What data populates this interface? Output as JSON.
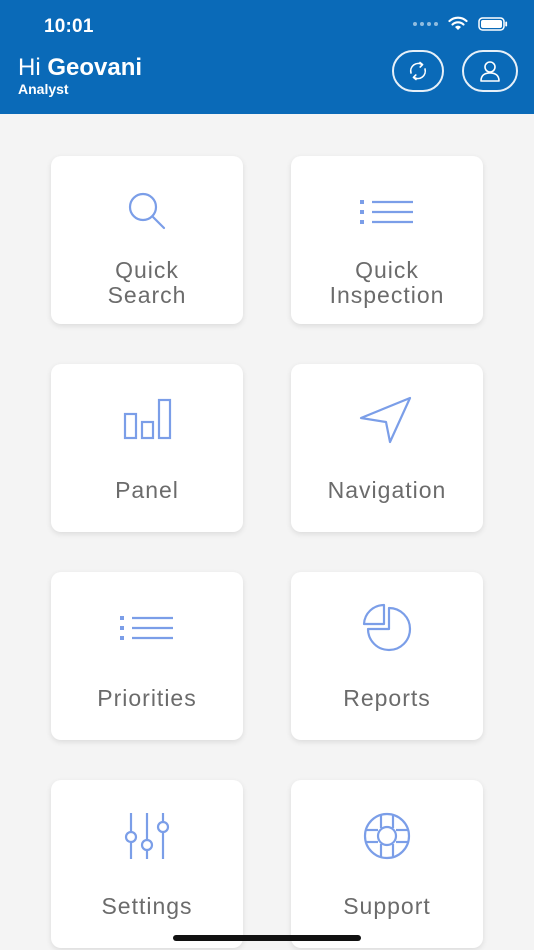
{
  "status_bar": {
    "time": "10:01"
  },
  "header": {
    "greeting_prefix": "Hi",
    "user_name": "Geovani",
    "role": "Analyst",
    "sync_icon": "sync-icon",
    "profile_icon": "user-icon"
  },
  "colors": {
    "header_bg": "#0a6ab8",
    "icon_accent": "#7b9ee8",
    "tile_text": "#6b6b6b",
    "page_bg": "#f4f4f4"
  },
  "tiles": [
    {
      "line1": "Quick",
      "line2": "Search",
      "icon": "search-icon"
    },
    {
      "line1": "Quick",
      "line2": "Inspection",
      "icon": "list-icon"
    },
    {
      "label": "Panel",
      "icon": "bar-chart-icon"
    },
    {
      "label": "Navigation",
      "icon": "navigation-arrow-icon"
    },
    {
      "label": "Priorities",
      "icon": "list-icon"
    },
    {
      "label": "Reports",
      "icon": "pie-chart-icon"
    },
    {
      "label": "Settings",
      "icon": "sliders-icon"
    },
    {
      "label": "Support",
      "icon": "lifebuoy-icon"
    }
  ]
}
